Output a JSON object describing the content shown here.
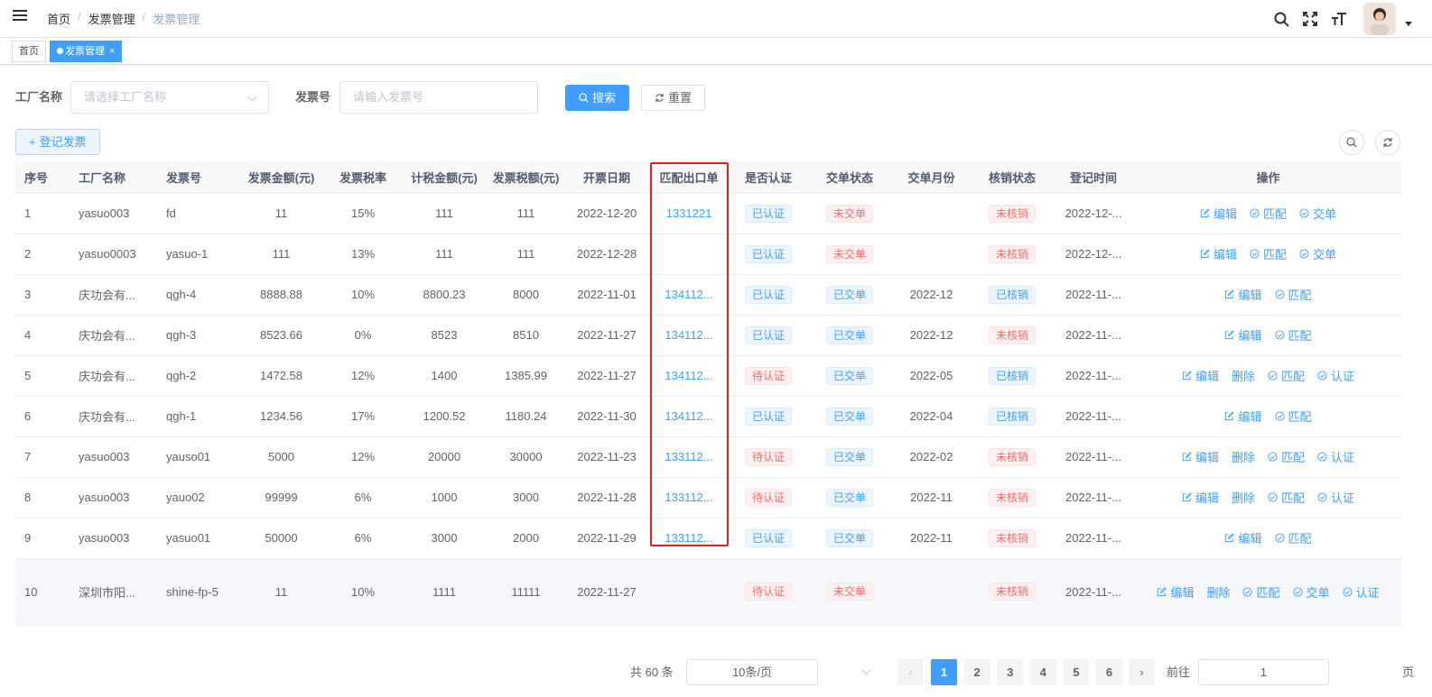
{
  "breadcrumb": [
    "首页",
    "发票管理",
    "发票管理"
  ],
  "tags": {
    "home": "首页",
    "active": "发票管理",
    "close": "×"
  },
  "filters": {
    "factory_label": "工厂名称",
    "factory_placeholder": "请选择工厂名称",
    "invoice_label": "发票号",
    "invoice_placeholder": "请输入发票号",
    "search": "搜索",
    "reset": "重置"
  },
  "toolbar": {
    "register": "登记发票"
  },
  "colors": {
    "primary": "#409eff",
    "danger": "#f56c6c",
    "highlight_box": "#e02020"
  },
  "table": {
    "columns": [
      "序号",
      "工厂名称",
      "发票号",
      "发票金额(元)",
      "发票税率",
      "计税金额(元)",
      "发票税额(元)",
      "开票日期",
      "匹配出口单",
      "是否认证",
      "交单状态",
      "交单月份",
      "核销状态",
      "登记时间",
      "操作"
    ],
    "rows": [
      {
        "no": "1",
        "factory": "yasuo003",
        "invoice": "fd",
        "amount": "11",
        "rate": "15%",
        "taxable": "111",
        "tax": "111",
        "date": "2022-12-20",
        "export": "1331221",
        "auth": "已认证",
        "submit": "未交单",
        "month": "",
        "writeoff": "未核销",
        "reg": "2022-12-...",
        "ops": [
          "编辑",
          "匹配",
          "交单"
        ]
      },
      {
        "no": "2",
        "factory": "yasuo0003",
        "invoice": "yasuo-1",
        "amount": "111",
        "rate": "13%",
        "taxable": "111",
        "tax": "111",
        "date": "2022-12-28",
        "export": "",
        "auth": "已认证",
        "submit": "未交单",
        "month": "",
        "writeoff": "未核销",
        "reg": "2022-12-...",
        "ops": [
          "编辑",
          "匹配",
          "交单"
        ]
      },
      {
        "no": "3",
        "factory": "庆功会有...",
        "invoice": "qgh-4",
        "amount": "8888.88",
        "rate": "10%",
        "taxable": "8800.23",
        "tax": "8000",
        "date": "2022-11-01",
        "export": "134112...",
        "auth": "已认证",
        "submit": "已交单",
        "month": "2022-12",
        "writeoff": "已核销",
        "reg": "2022-11-...",
        "ops": [
          "编辑",
          "匹配"
        ]
      },
      {
        "no": "4",
        "factory": "庆功会有...",
        "invoice": "qgh-3",
        "amount": "8523.66",
        "rate": "0%",
        "taxable": "8523",
        "tax": "8510",
        "date": "2022-11-27",
        "export": "134112...",
        "auth": "已认证",
        "submit": "已交单",
        "month": "2022-12",
        "writeoff": "未核销",
        "reg": "2022-11-...",
        "ops": [
          "编辑",
          "匹配"
        ]
      },
      {
        "no": "5",
        "factory": "庆功会有...",
        "invoice": "qgh-2",
        "amount": "1472.58",
        "rate": "12%",
        "taxable": "1400",
        "tax": "1385.99",
        "date": "2022-11-27",
        "export": "134112...",
        "auth": "待认证",
        "submit": "已交单",
        "month": "2022-05",
        "writeoff": "已核销",
        "reg": "2022-11-...",
        "ops": [
          "编辑",
          "删除",
          "匹配",
          "认证"
        ]
      },
      {
        "no": "6",
        "factory": "庆功会有...",
        "invoice": "qgh-1",
        "amount": "1234.56",
        "rate": "17%",
        "taxable": "1200.52",
        "tax": "1180.24",
        "date": "2022-11-30",
        "export": "134112...",
        "auth": "已认证",
        "submit": "已交单",
        "month": "2022-04",
        "writeoff": "已核销",
        "reg": "2022-11-...",
        "ops": [
          "编辑",
          "匹配"
        ]
      },
      {
        "no": "7",
        "factory": "yasuo003",
        "invoice": "yauso01",
        "amount": "5000",
        "rate": "12%",
        "taxable": "20000",
        "tax": "30000",
        "date": "2022-11-23",
        "export": "133112...",
        "auth": "待认证",
        "submit": "已交单",
        "month": "2022-02",
        "writeoff": "未核销",
        "reg": "2022-11-...",
        "ops": [
          "编辑",
          "删除",
          "匹配",
          "认证"
        ]
      },
      {
        "no": "8",
        "factory": "yasuo003",
        "invoice": "yauo02",
        "amount": "99999",
        "rate": "6%",
        "taxable": "1000",
        "tax": "3000",
        "date": "2022-11-28",
        "export": "133112...",
        "auth": "待认证",
        "submit": "已交单",
        "month": "2022-11",
        "writeoff": "未核销",
        "reg": "2022-11-...",
        "ops": [
          "编辑",
          "删除",
          "匹配",
          "认证"
        ]
      },
      {
        "no": "9",
        "factory": "yasuo003",
        "invoice": "yasuo01",
        "amount": "50000",
        "rate": "6%",
        "taxable": "3000",
        "tax": "2000",
        "date": "2022-11-29",
        "export": "133112...",
        "auth": "已认证",
        "submit": "已交单",
        "month": "2022-11",
        "writeoff": "未核销",
        "reg": "2022-11-...",
        "ops": [
          "编辑",
          "匹配"
        ]
      },
      {
        "no": "10",
        "factory": "深圳市阳...",
        "invoice": "shine-fp-5",
        "amount": "11",
        "rate": "10%",
        "taxable": "1111",
        "tax": "11111",
        "date": "2022-11-27",
        "export": "",
        "auth": "待认证",
        "submit": "未交单",
        "month": "",
        "writeoff": "未核销",
        "reg": "2022-11-...",
        "ops": [
          "编辑",
          "删除",
          "匹配",
          "交单",
          "认证"
        ]
      }
    ]
  },
  "pagination": {
    "total": "共 60 条",
    "page_size": "10条/页",
    "pages": [
      "1",
      "2",
      "3",
      "4",
      "5",
      "6"
    ],
    "current": "1",
    "goto_label": "前往",
    "goto_value": "1",
    "goto_suffix": "页"
  }
}
